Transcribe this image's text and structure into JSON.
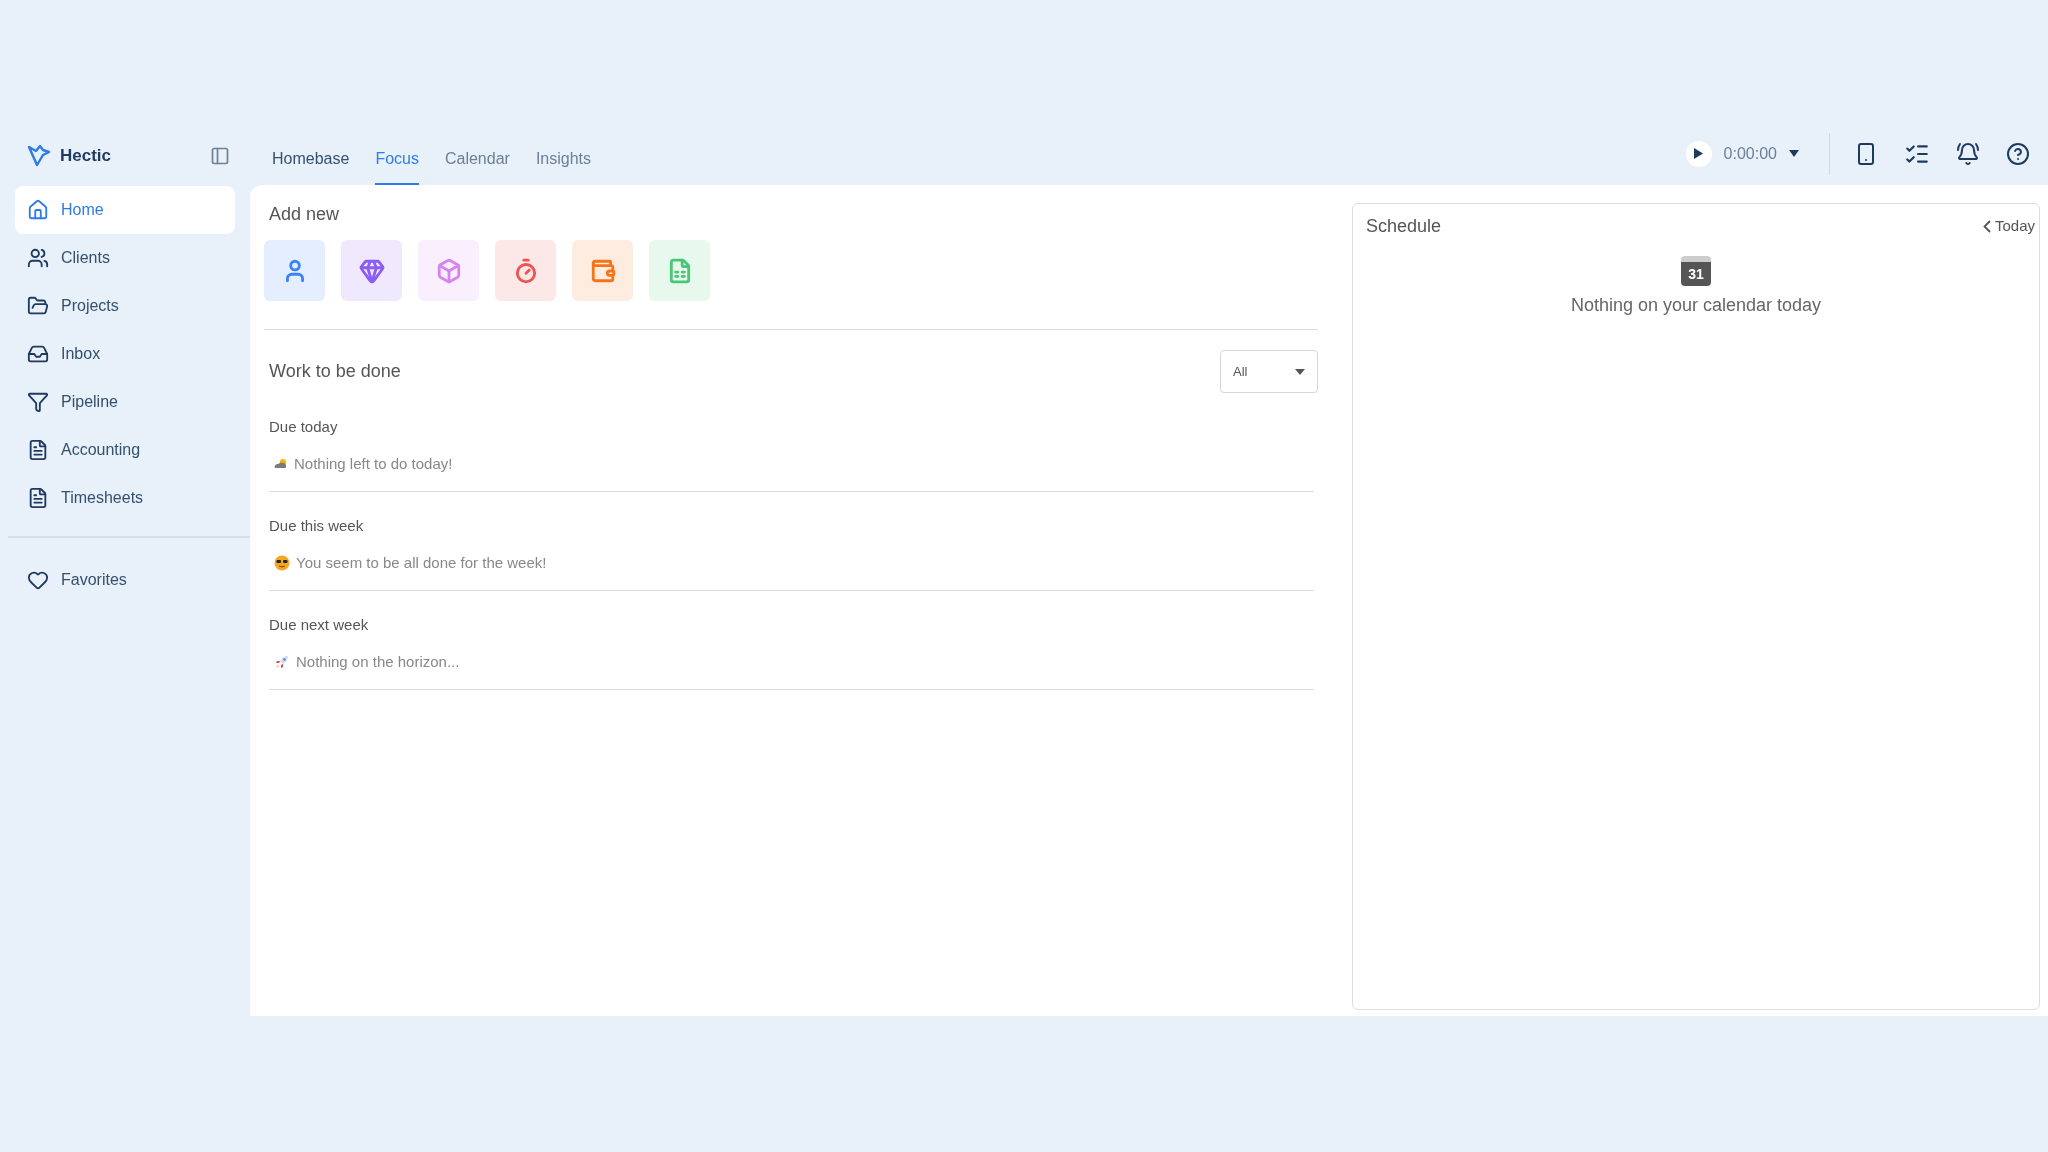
{
  "brand": {
    "name": "Hectic"
  },
  "sidebar": {
    "items": [
      {
        "label": "Home",
        "selected": true
      },
      {
        "label": "Clients",
        "selected": false
      },
      {
        "label": "Projects",
        "selected": false
      },
      {
        "label": "Inbox",
        "selected": false
      },
      {
        "label": "Pipeline",
        "selected": false
      },
      {
        "label": "Accounting",
        "selected": false
      },
      {
        "label": "Timesheets",
        "selected": false
      }
    ],
    "favorites": {
      "label": "Favorites",
      "selected": false
    }
  },
  "tabs": [
    {
      "label": "Homebase",
      "selected": false
    },
    {
      "label": "Focus",
      "selected": true
    },
    {
      "label": "Calendar",
      "selected": false
    },
    {
      "label": "Insights",
      "selected": false
    }
  ],
  "timer": {
    "time": "0:00:00"
  },
  "add_new": {
    "title": "Add new",
    "buttons": [
      {
        "color": "#3b82f6"
      },
      {
        "color": "#8b5cf6"
      },
      {
        "color": "#d884f0"
      },
      {
        "color": "#f05252"
      },
      {
        "color": "#f97316"
      },
      {
        "color": "#48c774"
      }
    ]
  },
  "work": {
    "title": "Work to be done",
    "filter": {
      "value": "All"
    },
    "groups": [
      {
        "heading": "Due today",
        "message": "Nothing left to do today!"
      },
      {
        "heading": "Due this week",
        "message": "You seem to be all done for the week!"
      },
      {
        "heading": "Due next week",
        "message": "Nothing on the horizon..."
      }
    ]
  },
  "schedule": {
    "title": "Schedule",
    "nav": "Today",
    "calendar_day": "31",
    "message": "Nothing on your calendar today"
  }
}
